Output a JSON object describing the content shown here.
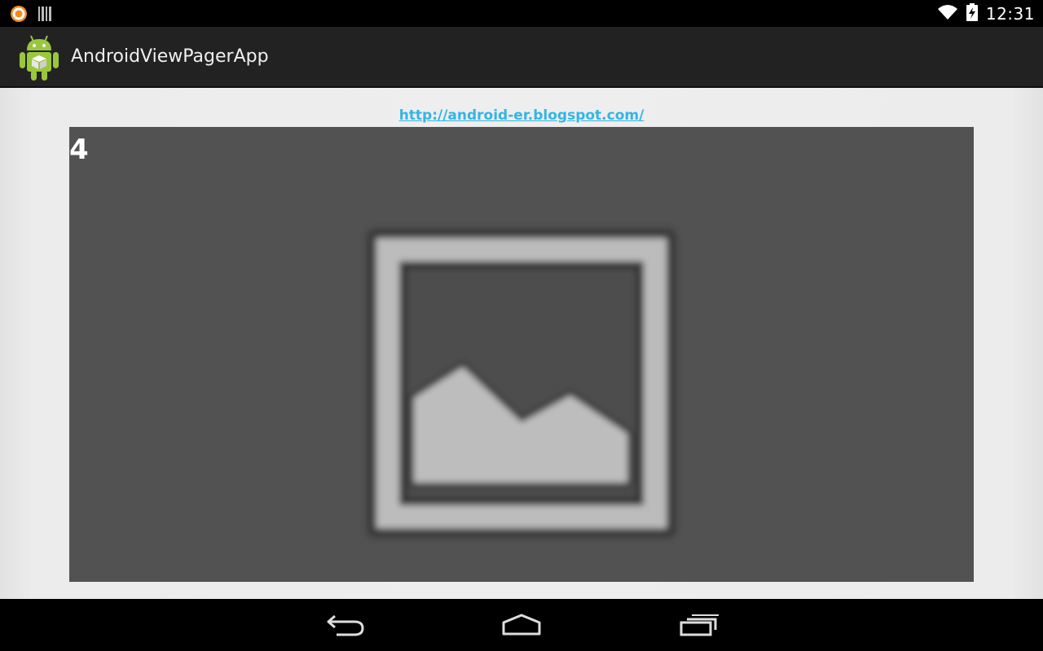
{
  "status_bar": {
    "time": "12:31",
    "icons": [
      "notification-app-icon",
      "notification-barcode-icon",
      "wifi-icon",
      "battery-charging-icon"
    ]
  },
  "action_bar": {
    "title": "AndroidViewPagerApp",
    "icon": "android-app-icon"
  },
  "content": {
    "link_text": "http://android-er.blogspot.com/",
    "pager": {
      "page_number": "4",
      "image": "image-placeholder-icon"
    }
  },
  "nav_bar": {
    "buttons": [
      "back-icon",
      "home-icon",
      "recent-apps-icon"
    ]
  },
  "colors": {
    "action_bar_bg": "#222222",
    "content_bg": "#eeeeee",
    "pager_bg": "#525252",
    "link": "#33b5e5"
  }
}
